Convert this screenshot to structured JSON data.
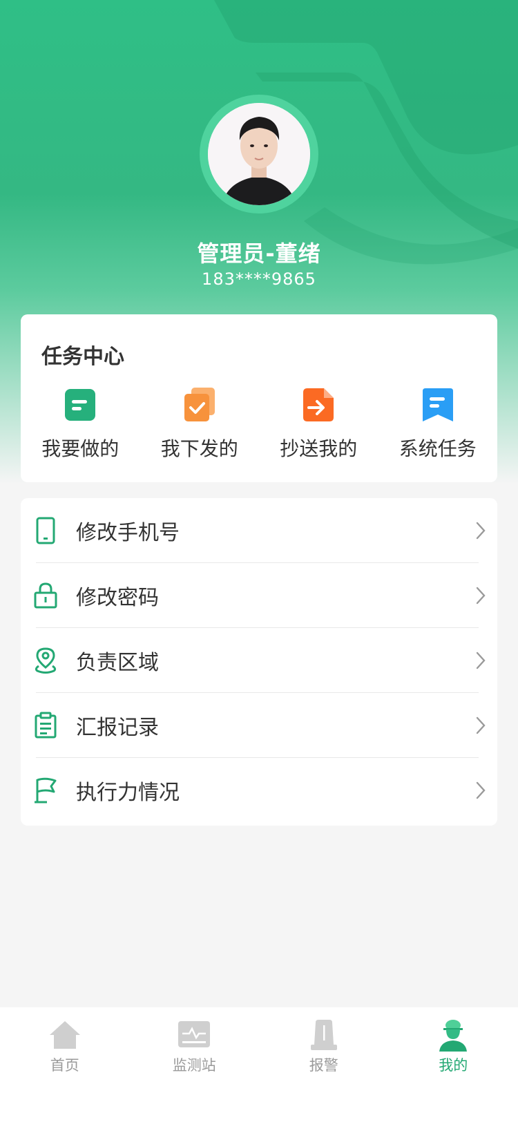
{
  "profile": {
    "name": "管理员-董绪",
    "phone": "183****9865"
  },
  "task_center": {
    "title": "任务中心",
    "items": [
      {
        "label": "我要做的",
        "icon": "todo-icon",
        "color": "#26b07c"
      },
      {
        "label": "我下发的",
        "icon": "issued-icon",
        "color": "#f7923c"
      },
      {
        "label": "抄送我的",
        "icon": "cc-icon",
        "color": "#fb6a23"
      },
      {
        "label": "系统任务",
        "icon": "system-task-icon",
        "color": "#2a9ef5"
      }
    ]
  },
  "menu": {
    "items": [
      {
        "label": "修改手机号",
        "icon": "phone-icon"
      },
      {
        "label": "修改密码",
        "icon": "lock-icon"
      },
      {
        "label": "负责区域",
        "icon": "location-icon"
      },
      {
        "label": "汇报记录",
        "icon": "clipboard-icon"
      },
      {
        "label": "执行力情况",
        "icon": "flag-icon"
      }
    ]
  },
  "tabbar": {
    "tabs": [
      {
        "label": "首页",
        "icon": "home-icon",
        "active": false
      },
      {
        "label": "监测站",
        "icon": "monitor-icon",
        "active": false
      },
      {
        "label": "报警",
        "icon": "alarm-icon",
        "active": false
      },
      {
        "label": "我的",
        "icon": "profile-icon",
        "active": true
      }
    ]
  },
  "colors": {
    "brand": "#23a873",
    "hero_top": "#2fbf86",
    "inactive": "#9a9a9a"
  }
}
